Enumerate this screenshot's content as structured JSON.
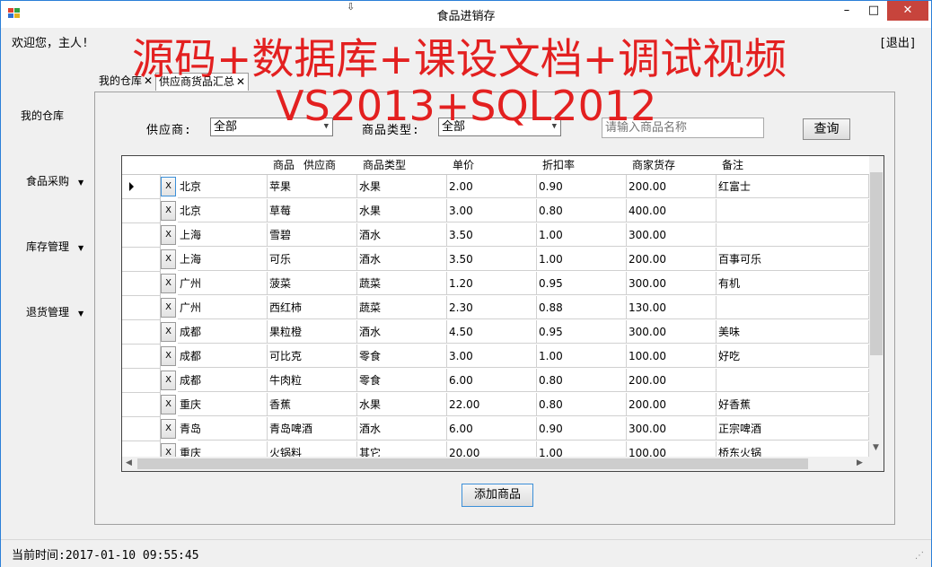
{
  "window": {
    "title": "食品进销存",
    "min_label": "–",
    "max_label": "□",
    "close_label": "✕"
  },
  "header": {
    "welcome": "欢迎您，主人!",
    "logout": "[退出]"
  },
  "watermark": {
    "line1": "源码+数据库+课设文档+调试视频",
    "line2": "VS2013+SQL2012"
  },
  "sidebar": {
    "items": [
      {
        "label": "我的仓库",
        "has_arrow": false
      },
      {
        "label": "食品采购",
        "has_arrow": true
      },
      {
        "label": "库存管理",
        "has_arrow": true
      },
      {
        "label": "退货管理",
        "has_arrow": true
      }
    ]
  },
  "tabs": [
    {
      "label": "我的仓库",
      "close": "✕",
      "active": false
    },
    {
      "label": "供应商货品汇总",
      "close": "✕",
      "active": true
    }
  ],
  "filters": {
    "supplier_label": "供应商:",
    "supplier_value": "全部",
    "type_label": "商品类型:",
    "type_value": "全部",
    "search_placeholder": "请输入商品名称",
    "query_label": "查询"
  },
  "grid": {
    "columns": [
      "供应商",
      "商品",
      "商品类型",
      "单价",
      "折扣率",
      "商家货存",
      "备注"
    ],
    "delete_label": "X",
    "rows": [
      [
        "北京",
        "苹果",
        "水果",
        "2.00",
        "0.90",
        "200.00",
        "红富士"
      ],
      [
        "北京",
        "草莓",
        "水果",
        "3.00",
        "0.80",
        "400.00",
        ""
      ],
      [
        "上海",
        "雪碧",
        "酒水",
        "3.50",
        "1.00",
        "300.00",
        ""
      ],
      [
        "上海",
        "可乐",
        "酒水",
        "3.50",
        "1.00",
        "200.00",
        "百事可乐"
      ],
      [
        "广州",
        "菠菜",
        "蔬菜",
        "1.20",
        "0.95",
        "300.00",
        "有机"
      ],
      [
        "广州",
        "西红柿",
        "蔬菜",
        "2.30",
        "0.88",
        "130.00",
        ""
      ],
      [
        "成都",
        "果粒橙",
        "酒水",
        "4.50",
        "0.95",
        "300.00",
        "美味"
      ],
      [
        "成都",
        "可比克",
        "零食",
        "3.00",
        "1.00",
        "100.00",
        "好吃"
      ],
      [
        "成都",
        "牛肉粒",
        "零食",
        "6.00",
        "0.80",
        "200.00",
        ""
      ],
      [
        "重庆",
        "香蕉",
        "水果",
        "22.00",
        "0.80",
        "200.00",
        "好香蕉"
      ],
      [
        "青岛",
        "青岛啤酒",
        "酒水",
        "6.00",
        "0.90",
        "300.00",
        "正宗啤酒"
      ],
      [
        "重庆",
        "火锅料",
        "其它",
        "20.00",
        "1.00",
        "100.00",
        "桥东火锅"
      ]
    ]
  },
  "actions": {
    "add_label": "添加商品"
  },
  "status": {
    "text": "当前时间:2017-01-10  09:55:45"
  },
  "colors": {
    "watermark": "#e32020",
    "close_button": "#c7443c",
    "focus_border": "#3b8fd8"
  }
}
